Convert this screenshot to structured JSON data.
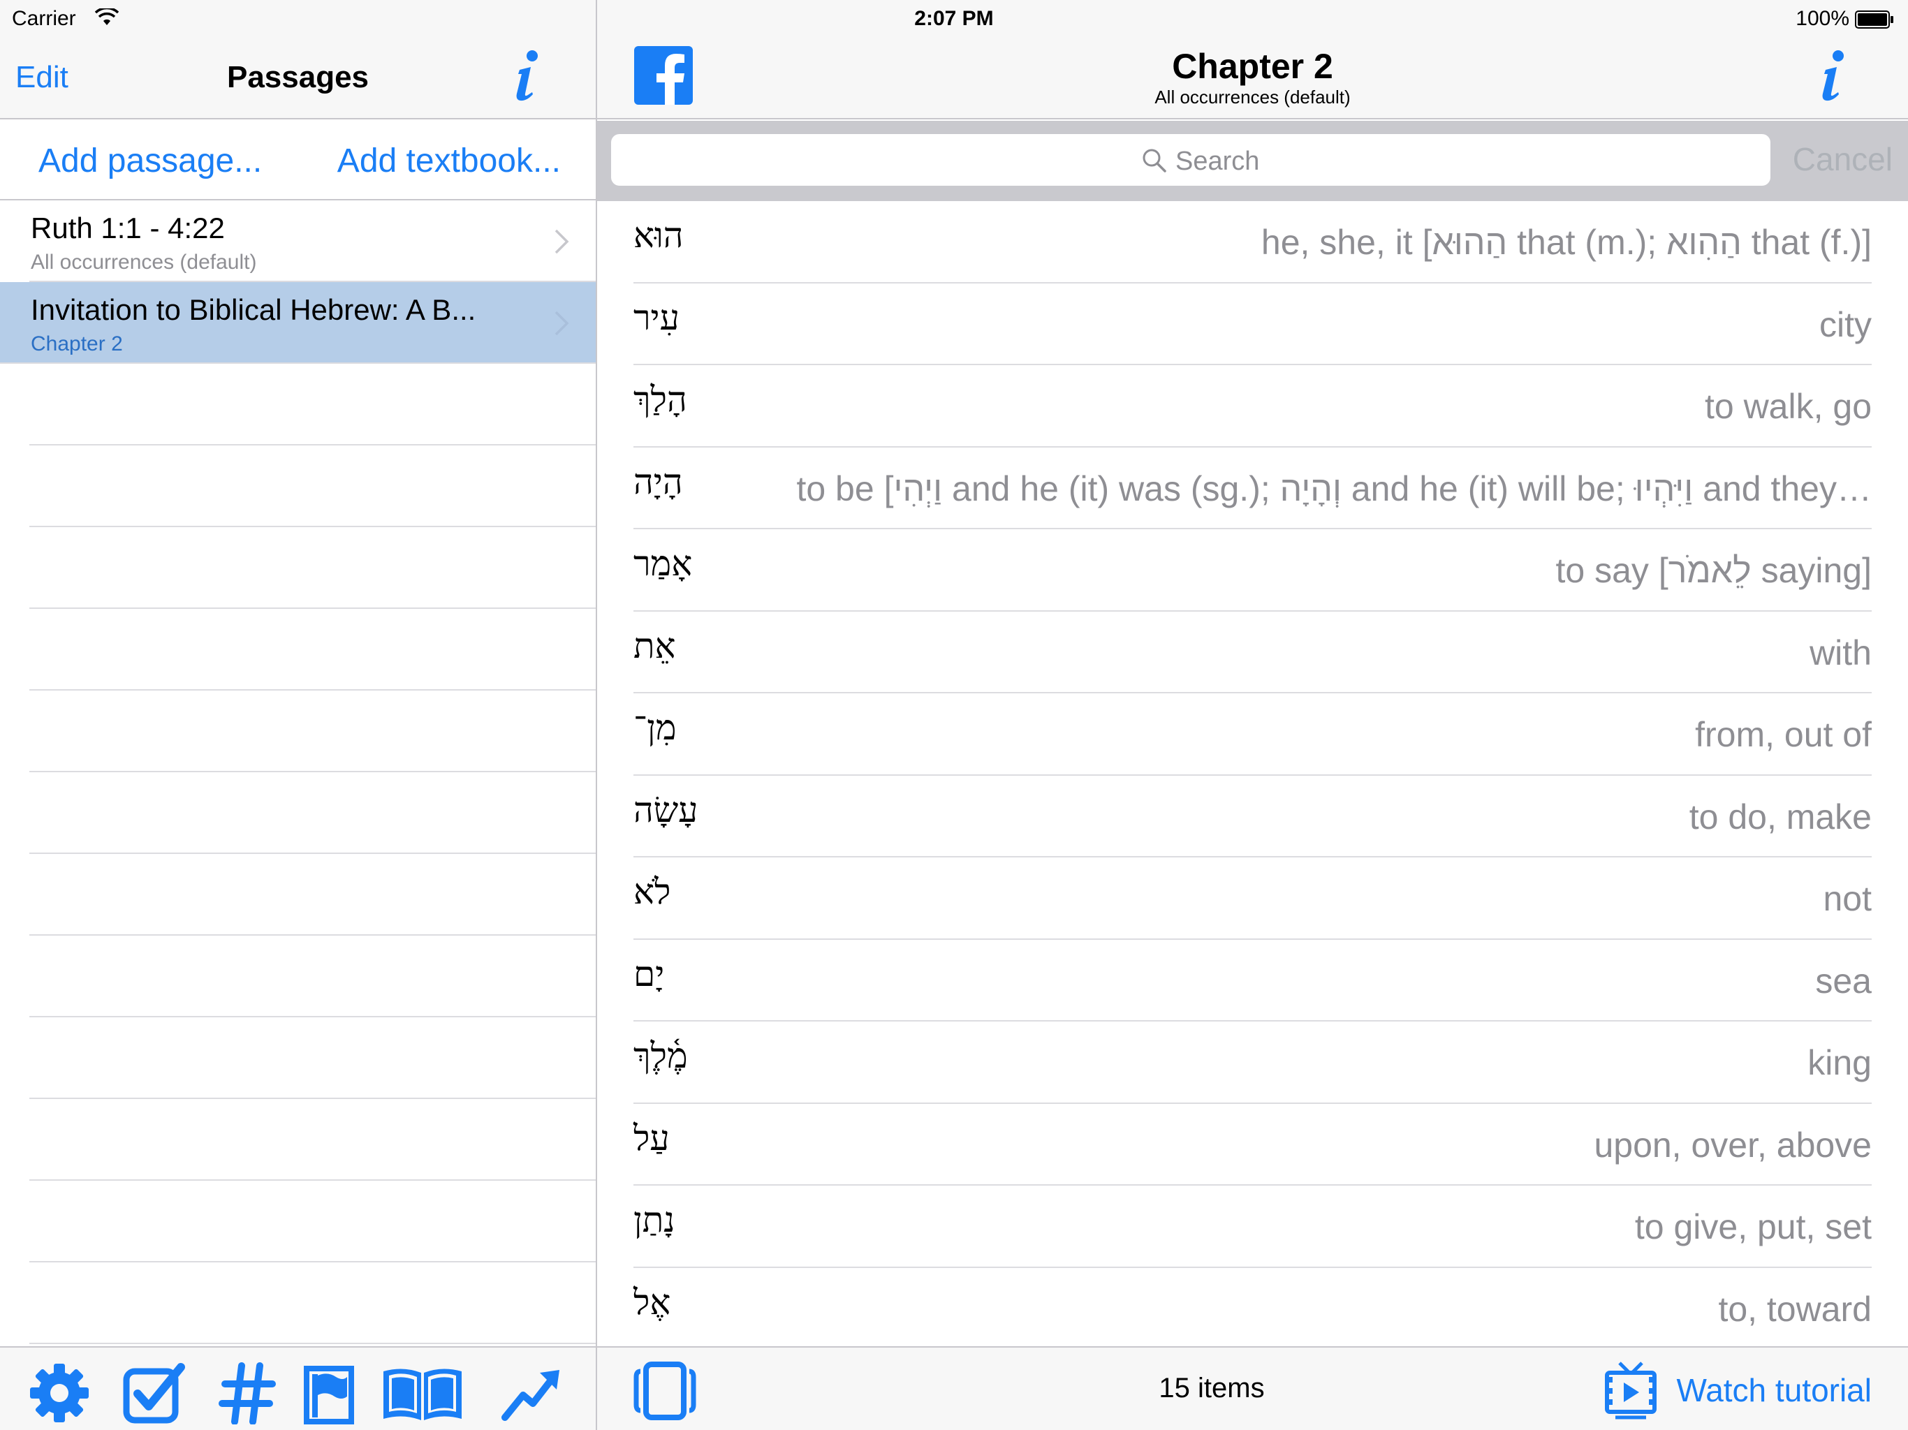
{
  "status_bar": {
    "carrier": "Carrier",
    "time": "2:07 PM",
    "battery": "100%"
  },
  "left_nav": {
    "edit_label": "Edit",
    "title": "Passages"
  },
  "add_row": {
    "add_passage": "Add passage...",
    "add_textbook": "Add textbook..."
  },
  "passages": [
    {
      "title": "Ruth 1:1 - 4:22",
      "subtitle": "All occurrences (default)"
    },
    {
      "title": "Invitation to Biblical Hebrew: A B...",
      "subtitle": "Chapter 2"
    }
  ],
  "right_nav": {
    "title": "Chapter 2",
    "subtitle": "All occurrences (default)"
  },
  "search": {
    "placeholder": "Search",
    "cancel_label": "Cancel"
  },
  "words": [
    {
      "hebrew": "הוּא",
      "gloss": "he, she, it [הַהוּא that (m.); הַהִוא that (f.)]"
    },
    {
      "hebrew": "עִיר",
      "gloss": "city"
    },
    {
      "hebrew": "הָלַךְ",
      "gloss": "to walk, go"
    },
    {
      "hebrew": "הָיָה",
      "gloss": "to be [וַיְהִי and he (it) was  (sg.); וְהָיָה and he (it) will be; וַיִּהְיוּ and they…"
    },
    {
      "hebrew": "אָמַר",
      "gloss": "to say [לֵאמֹר saying]"
    },
    {
      "hebrew": "אֵת",
      "gloss": "with"
    },
    {
      "hebrew": "מִן־",
      "gloss": "from, out of"
    },
    {
      "hebrew": "עָשָׂה",
      "gloss": "to do, make"
    },
    {
      "hebrew": "לֹא",
      "gloss": "not"
    },
    {
      "hebrew": "יָם",
      "gloss": "sea"
    },
    {
      "hebrew": "מֶ֫לֶךְ",
      "gloss": "king"
    },
    {
      "hebrew": "עַל",
      "gloss": "upon, over, above"
    },
    {
      "hebrew": "נָתַן",
      "gloss": "to give, put, set"
    },
    {
      "hebrew": "אֶל",
      "gloss": "to, toward"
    }
  ],
  "bottom": {
    "count": "15 items",
    "watch_tutorial": "Watch tutorial"
  },
  "colors": {
    "accent": "#1a7ef5",
    "selection": "#b5cde8",
    "gloss_gray": "#8e8e93"
  },
  "icons": {
    "toolbar": [
      "gear-icon",
      "checkbox-icon",
      "hash-icon",
      "flag-icon",
      "book-icon",
      "trend-arrow-icon"
    ]
  }
}
